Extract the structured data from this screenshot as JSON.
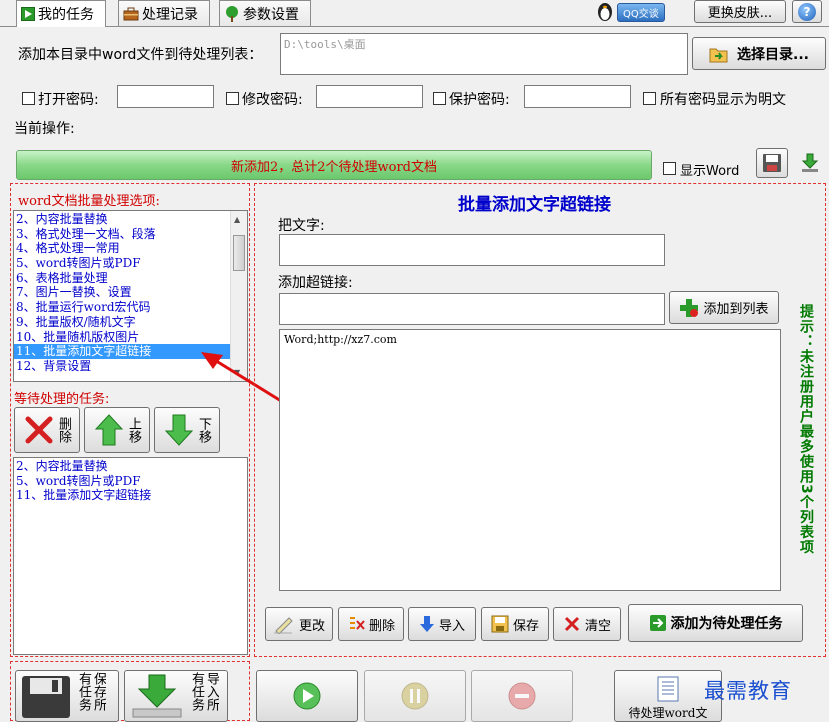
{
  "tabs": [
    {
      "label": "我的任务",
      "icon": "doc-play-icon"
    },
    {
      "label": "处理记录",
      "icon": "briefcase-icon"
    },
    {
      "label": "参数设置",
      "icon": "tree-icon"
    }
  ],
  "topright": {
    "qq_label": "QQ交谈",
    "skin_label": "更换皮肤...",
    "help_label": "?"
  },
  "directory": {
    "label": "添加本目录中word文件到待处理列表：",
    "value": "D:\\tools\\桌面",
    "select_button": "选择目录..."
  },
  "passwords": {
    "open_label": "打开密码:",
    "modify_label": "修改密码:",
    "protect_label": "保护密码:",
    "show_plain_label": "所有密码显示为明文"
  },
  "current_op_label": "当前操作:",
  "progress": {
    "text": "新添加2，总计2个待处理word文档",
    "value": 1.0
  },
  "show_word_label": "显示Word",
  "options": {
    "title": "word文档批量处理选项:",
    "items": [
      "2、内容批量替换",
      "3、格式处理一文档、段落",
      "4、格式处理一常用",
      "5、word转图片或PDF",
      "6、表格批量处理",
      "7、图片一替换、设置",
      "8、批量运行word宏代码",
      "9、批量版权/随机文字",
      "10、批量随机版权图片",
      "11、批量添加文字超链接",
      "12、背景设置"
    ],
    "selected_index": 9
  },
  "pending": {
    "title": "等待处理的任务:",
    "delete_label": "删除",
    "up_label": "上移",
    "down_label": "下移",
    "items": [
      "2、内容批量替换",
      "5、word转图片或PDF",
      "11、批量添加文字超链接"
    ]
  },
  "panel": {
    "title": "批量添加文字超链接",
    "text_label": "把文字:",
    "text_value": "",
    "link_label": "添加超链接:",
    "link_value": "",
    "add_to_list_button": "添加到列表",
    "list_content": "Word;http://xz7.com",
    "tip": "提示：未注册用户最多使用3个列表项"
  },
  "action_buttons": {
    "modify": "更改",
    "delete": "删除",
    "import": "导入",
    "save": "保存",
    "clear": "清空",
    "add_task": "添加为待处理任务"
  },
  "bottom": {
    "save_all_label": "保存所有任务",
    "import_all_label": "导入所有任务",
    "pending_word_label": "待处理word文",
    "watermark": "最需教育"
  },
  "colors": {
    "accent_red": "#e03030",
    "link_blue": "#0000cc",
    "tip_green": "#007a00",
    "progress_green": "#88d888"
  }
}
